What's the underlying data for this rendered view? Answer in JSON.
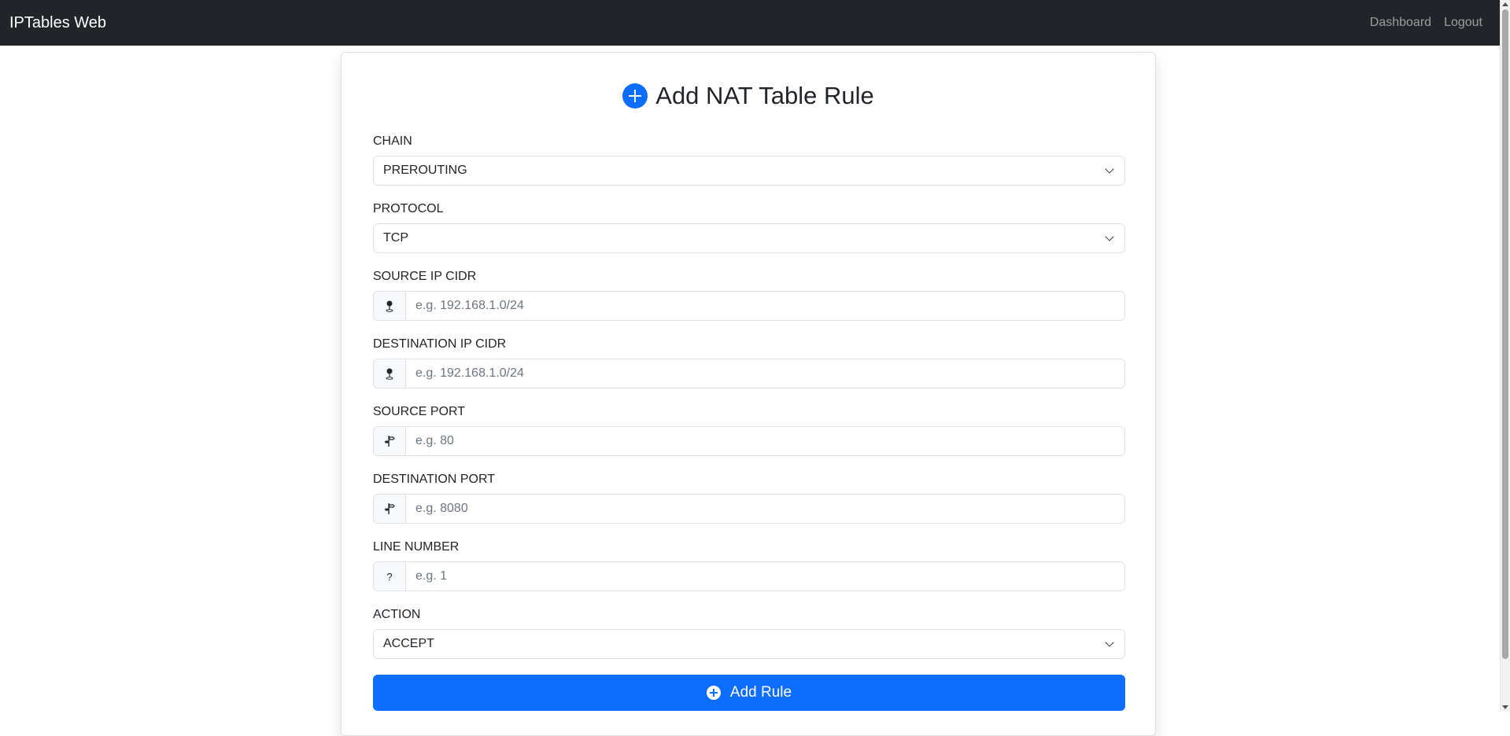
{
  "navbar": {
    "brand": "IPTables Web",
    "links": [
      "Dashboard",
      "Logout"
    ]
  },
  "form": {
    "title": "Add NAT Table Rule",
    "title_icon": "plus-circle-icon",
    "chain": {
      "label": "CHAIN",
      "value": "PREROUTING"
    },
    "protocol": {
      "label": "PROTOCOL",
      "value": "TCP"
    },
    "source_ip": {
      "label": "SOURCE IP CIDR",
      "placeholder": "e.g. 192.168.1.0/24",
      "value": "",
      "icon": "geo-pin-icon"
    },
    "destination_ip": {
      "label": "DESTINATION IP CIDR",
      "placeholder": "e.g. 192.168.1.0/24",
      "value": "",
      "icon": "geo-pin-icon"
    },
    "source_port": {
      "label": "SOURCE PORT",
      "placeholder": "e.g. 80",
      "value": "",
      "icon": "signpost-icon"
    },
    "destination_port": {
      "label": "DESTINATION PORT",
      "placeholder": "e.g. 8080",
      "value": "",
      "icon": "signpost-icon"
    },
    "line_number": {
      "label": "LINE NUMBER",
      "placeholder": "e.g. 1",
      "value": "",
      "addon": "?"
    },
    "action": {
      "label": "ACTION",
      "value": "ACCEPT"
    },
    "submit_label": "Add Rule"
  },
  "colors": {
    "navbar_bg": "#212529",
    "primary": "#0d6efd",
    "border": "#dee2e6"
  }
}
